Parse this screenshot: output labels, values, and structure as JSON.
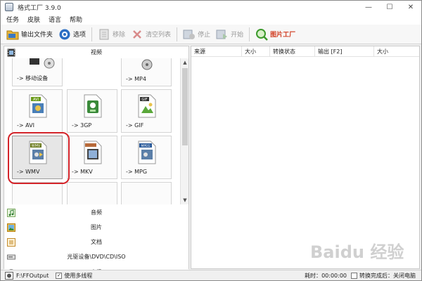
{
  "window": {
    "title": "格式工厂 3.9.0",
    "controls": {
      "minimize": "—",
      "maximize": "☐",
      "close": "✕"
    }
  },
  "menu": [
    "任务",
    "皮肤",
    "语言",
    "帮助"
  ],
  "toolbar": {
    "output_folder": "输出文件夹",
    "options": "选项",
    "remove": "移除",
    "clear_list": "清空列表",
    "stop": "停止",
    "start": "开始",
    "image_factory": "图片工厂"
  },
  "categories": {
    "video": "视频",
    "audio": "音频",
    "picture": "图片",
    "document": "文档",
    "rom": "光驱设备\\DVD\\CD\\ISO",
    "advanced": "高级"
  },
  "tiles": [
    {
      "label": "-> 移动设备",
      "badge": ""
    },
    {
      "label": "-> MP4",
      "badge": ""
    },
    {
      "label": "-> AVI",
      "badge": "AVI"
    },
    {
      "label": "-> 3GP",
      "badge": ""
    },
    {
      "label": "-> GIF",
      "badge": "GIF"
    },
    {
      "label": "-> WMV",
      "badge": "WMV"
    },
    {
      "label": "-> MKV",
      "badge": ""
    },
    {
      "label": "-> MPG",
      "badge": "MPEG"
    }
  ],
  "columns": [
    "来源",
    "大小",
    "转换状态",
    "输出 [F2]",
    "大小"
  ],
  "status": {
    "output_path": "F:\\FFOutput",
    "multithread": "使用多线程",
    "elapsed_label": "耗时：",
    "elapsed": "00:00:00",
    "after_convert": "转换完成后：关闭电脑"
  },
  "watermark": "Baidu 经验",
  "colors": {
    "highlight": "#d4242a",
    "accent": "#2a7fd4"
  }
}
